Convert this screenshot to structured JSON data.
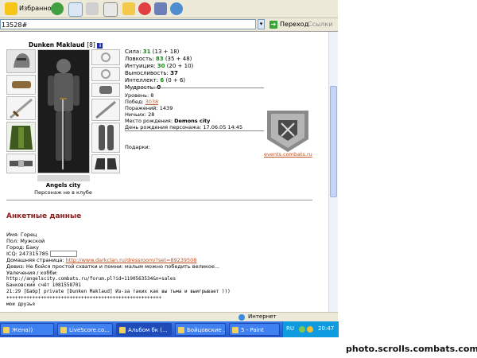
{
  "toolbar": {
    "favorites_label": "Избранное"
  },
  "address": {
    "url": "13528#",
    "go_label": "Переход",
    "links_label": "Ссылки"
  },
  "profile": {
    "name": "Dunken Maklaud",
    "level_bracket": "[8]",
    "city": "Angels city",
    "club_status": "Персонаж не в клубе",
    "stats": {
      "strength_label": "Сила:",
      "strength_value": "31",
      "strength_extra": "(13 + 18)",
      "agility_label": "Ловкость:",
      "agility_value": "83",
      "agility_extra": "(35 + 48)",
      "intuition_label": "Интуиция:",
      "intuition_value": "30",
      "intuition_extra": "(20 + 10)",
      "endurance_label": "Выносливость:",
      "endurance_value": "37",
      "intellect_label": "Интеллект:",
      "intellect_value": "6",
      "intellect_extra": "(0 + 6)",
      "wisdom_label": "Мудрость:",
      "wisdom_value": "0"
    },
    "info": {
      "level": "Уровень: 8",
      "wins_label": "Побед:",
      "wins_value": "3038",
      "losses": "Поражений: 1439",
      "draws": "Ничьих: 28",
      "birthplace_label": "Место рождения:",
      "birthplace_value": "Demons city",
      "birthday": "День рождения персонажа: 17.06.05 14:45"
    },
    "gifts_label": "Подарки:",
    "clan_link": "events.combats.ru"
  },
  "questionnaire": {
    "title": "Анкетные данные",
    "name": "Имя: Горец",
    "gender": "Пол: Мужской",
    "city": "Город: Баку",
    "icq": "ICQ: 247315785",
    "homepage_label": "Домашняя страница:",
    "homepage_url": "http://www.darkclan.ru/dressroom/?set=89239508",
    "motto": "Девиз: Не бойся простой схватки и помни: малым можно победить великое...",
    "hobby_label": "Увлечения / хобби:",
    "hobby_url": "http://angelscity.combats.ru/forum.pl?id=1190563534&n=sales",
    "bank": "Банковский счёт 1081558701",
    "chat": "21:29 [Бабр] private [Dunken Maklaud] Из-за таких как вы тьма и выигрывает )))",
    "plusline": "++++++++++++++++++++++++++++++++++++++++++++++++++++++",
    "friends": "мои друзья"
  },
  "statusbar": {
    "zone_label": "Интернет"
  },
  "taskbar": {
    "items": [
      "Жена))",
      "LiveScore.co...",
      "Альбом бк (...",
      "Бойцовские ...",
      "5 - Paint"
    ],
    "lang": "RU",
    "time": "20:47"
  },
  "watermark": "photo.scrolls.combats.com"
}
